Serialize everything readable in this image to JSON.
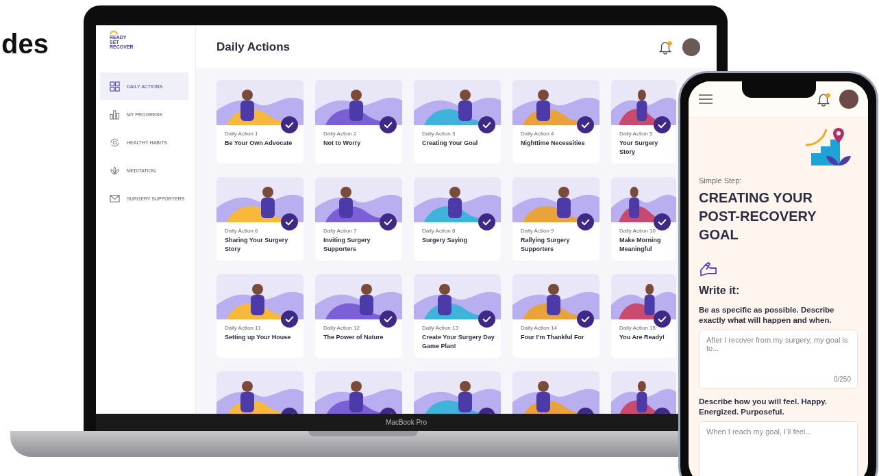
{
  "heading": "des",
  "laptop": {
    "label": "MacBook Pro",
    "logo": [
      "READY",
      "SET",
      "RECOVER"
    ],
    "sidebar": {
      "items": [
        {
          "label": "DAILY ACTIONS",
          "kind": "grid",
          "selected": true
        },
        {
          "label": "MY PROGRESS",
          "kind": "bars",
          "selected": false
        },
        {
          "label": "HEALTHY HABITS",
          "kind": "cycle",
          "selected": false
        },
        {
          "label": "MEDITATION",
          "kind": "lotus",
          "selected": false
        },
        {
          "label": "SURGERY SUPPORTERS",
          "kind": "mail",
          "selected": false
        }
      ]
    },
    "page_title": "Daily Actions",
    "cards": [
      {
        "number": "Daily Action 1",
        "title": "Be Your Own Advocate",
        "completed": true
      },
      {
        "number": "Daily Action 2",
        "title": "Not to Worry",
        "completed": true
      },
      {
        "number": "Daily Action 3",
        "title": "Creating Your Goal",
        "completed": true
      },
      {
        "number": "Daily Action 4",
        "title": "Nighttime Necessities",
        "completed": true
      },
      {
        "number": "Daily Action 5",
        "title": "Your Surgery Story",
        "completed": true
      },
      {
        "number": "Daily Action 6",
        "title": "Sharing Your Surgery Story",
        "completed": true
      },
      {
        "number": "Daily Action 7",
        "title": "Inviting Surgery Supporters",
        "completed": true
      },
      {
        "number": "Daily Action 8",
        "title": "Surgery Saying",
        "completed": true
      },
      {
        "number": "Daily Action 9",
        "title": "Rallying Surgery Supporters",
        "completed": true
      },
      {
        "number": "Daily Action 10",
        "title": "Make Morning Meaningful",
        "completed": true
      },
      {
        "number": "Daily Action 11",
        "title": "Setting up Your House",
        "completed": true
      },
      {
        "number": "Daily Action 12",
        "title": "The Power of Nature",
        "completed": true
      },
      {
        "number": "Daily Action 13",
        "title": "Create Your Surgery Day Game Plan!",
        "completed": true
      },
      {
        "number": "Daily Action 14",
        "title": "Four I’m Thankful For",
        "completed": true
      },
      {
        "number": "Daily Action 15",
        "title": "You Are Ready!",
        "completed": true
      },
      {
        "completed": true
      },
      {
        "completed": true
      },
      {
        "completed": true
      },
      {
        "completed": true
      },
      {
        "completed": true
      }
    ]
  },
  "phone": {
    "eyebrow": "Simple Step:",
    "title": "CREATING YOUR POST-RECOVERY GOAL",
    "section": "Write it:",
    "prompts": [
      {
        "label": "Be as specific as possible. Describe exactly what will happen and when.",
        "placeholder": "After I recover from my surgery, my goal is to...",
        "counter": "0/250"
      },
      {
        "label": "Describe how you will feel. Happy. Energized. Purposeful.",
        "placeholder": "When I reach my goal, I’ll feel..."
      }
    ]
  }
}
